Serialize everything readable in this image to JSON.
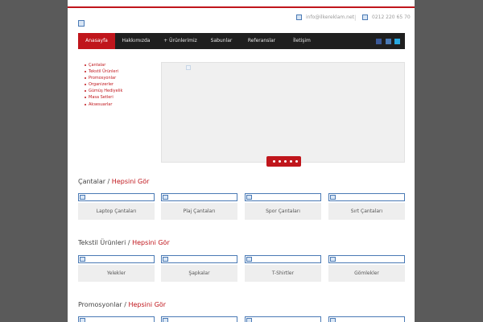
{
  "header": {
    "email": "info@ilkereklam.net",
    "separator": "|",
    "phone": "0212 220 65 70"
  },
  "nav": {
    "items": [
      "Anasayfa",
      "Hakkımızda",
      "+ Ürünlerimiz",
      "Sabunlar",
      "Referanslar",
      "İletişim"
    ],
    "active_index": 0,
    "social_icons": [
      "facebook-icon",
      "linkedin-icon",
      "twitter-icon"
    ]
  },
  "categories": [
    "Çantalar",
    "Tekstil Ürünleri",
    "Promosyonlar",
    "Organizerler",
    "Gümüş Hediyelik",
    "Masa Setleri",
    "Aksesuarlar"
  ],
  "slider": {
    "dots": 5
  },
  "sections": [
    {
      "title": "Çantalar",
      "sep": " / ",
      "link": "Hepsini Gör",
      "items": [
        "Laptop Çantaları",
        "Plaj Çantaları",
        "Spor Çantaları",
        "Sırt Çantaları"
      ]
    },
    {
      "title": "Tekstil Ürünleri",
      "sep": " / ",
      "link": "Hepsini Gör",
      "items": [
        "Yelekler",
        "Şapkalar",
        "T-Shirtler",
        "Gömlekler"
      ]
    },
    {
      "title": "Promosyonlar",
      "sep": " / ",
      "link": "Hepsini Gör",
      "items": [
        "",
        "",
        "",
        ""
      ]
    }
  ],
  "colors": {
    "brand_red": "#c0161c",
    "nav_bg": "#1f1f1f",
    "frame_bg": "#5a5a5a"
  }
}
